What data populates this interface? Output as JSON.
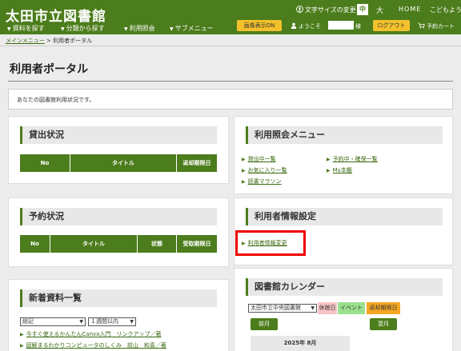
{
  "header": {
    "site_title": "太田市立図書館",
    "nav": [
      "資料を探す",
      "分類から探す",
      "利用照会",
      "サブメニュー"
    ],
    "font_size_label": "文字サイズの変更",
    "font_size_mid": "中",
    "font_size_large": "大",
    "home": "HOME",
    "kodomo": "こどもよう",
    "image_button": "画像表示ON",
    "welcome": "ようこそ",
    "user_suffix": "様",
    "logout": "ログアウト",
    "cart": "予約カート"
  },
  "breadcrumb": {
    "parent": "メインメニュー",
    "sep": ">",
    "current": "利用者ポータル"
  },
  "page_title": "利用者ポータル",
  "status_message": "あなたの図書館利用状況です。",
  "loan": {
    "title": "貸出状況",
    "columns": [
      "No",
      "タイトル",
      "返却期限日"
    ]
  },
  "reserve": {
    "title": "予約状況",
    "columns": [
      "No",
      "タイトル",
      "状態",
      "受取期限日"
    ]
  },
  "new_items": {
    "title": "新着資料一覧",
    "category": "総記",
    "period": "１週間以内",
    "items": [
      "今すぐ使えるかんたんCanva入門　リンクアップ／著",
      "図解まるわかりコンピュータのしくみ　前山　和喜／著"
    ]
  },
  "inquiry": {
    "title": "利用照会メニュー",
    "links": [
      "貸出中一覧",
      "お気に入り一覧",
      "読書マラソン",
      "予約中・確保一覧",
      "My本棚"
    ]
  },
  "user_settings": {
    "title": "利用者情報設定",
    "link": "利用者情報変更"
  },
  "calendar": {
    "title": "図書館カレンダー",
    "library": "太田市立中央図書館",
    "legend": {
      "closed": "休館日",
      "event": "イベント",
      "due": "返却期限日"
    },
    "prev": "前月",
    "next": "翌月",
    "month": "2025年 8月"
  },
  "colors": {
    "primary": "#4c7d1c",
    "button": "#f3c12c",
    "highlight": "#e00000",
    "closed": "#f7c3c7",
    "event": "#9be08d",
    "due": "#f5a623"
  }
}
